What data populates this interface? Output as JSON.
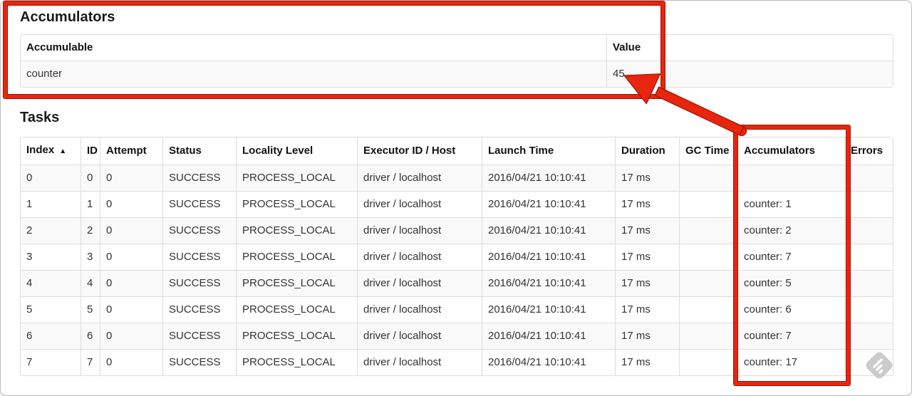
{
  "accumulators_section": {
    "title": "Accumulators",
    "table": {
      "columns": [
        "Accumulable",
        "Value"
      ],
      "rows": [
        {
          "accumulable": "counter",
          "value": "45"
        }
      ]
    }
  },
  "tasks_section": {
    "title": "Tasks",
    "table": {
      "columns": [
        "Index",
        "ID",
        "Attempt",
        "Status",
        "Locality Level",
        "Executor ID / Host",
        "Launch Time",
        "Duration",
        "GC Time",
        "Accumulators",
        "Errors"
      ],
      "sort_indicator": "▲",
      "rows": [
        {
          "index": "0",
          "id": "0",
          "attempt": "0",
          "status": "SUCCESS",
          "locality_level": "PROCESS_LOCAL",
          "executor_id_host": "driver / localhost",
          "launch_time": "2016/04/21 10:10:41",
          "duration": "17 ms",
          "gc_time": "",
          "accumulators": "",
          "errors": ""
        },
        {
          "index": "1",
          "id": "1",
          "attempt": "0",
          "status": "SUCCESS",
          "locality_level": "PROCESS_LOCAL",
          "executor_id_host": "driver / localhost",
          "launch_time": "2016/04/21 10:10:41",
          "duration": "17 ms",
          "gc_time": "",
          "accumulators": "counter: 1",
          "errors": ""
        },
        {
          "index": "2",
          "id": "2",
          "attempt": "0",
          "status": "SUCCESS",
          "locality_level": "PROCESS_LOCAL",
          "executor_id_host": "driver / localhost",
          "launch_time": "2016/04/21 10:10:41",
          "duration": "17 ms",
          "gc_time": "",
          "accumulators": "counter: 2",
          "errors": ""
        },
        {
          "index": "3",
          "id": "3",
          "attempt": "0",
          "status": "SUCCESS",
          "locality_level": "PROCESS_LOCAL",
          "executor_id_host": "driver / localhost",
          "launch_time": "2016/04/21 10:10:41",
          "duration": "17 ms",
          "gc_time": "",
          "accumulators": "counter: 7",
          "errors": ""
        },
        {
          "index": "4",
          "id": "4",
          "attempt": "0",
          "status": "SUCCESS",
          "locality_level": "PROCESS_LOCAL",
          "executor_id_host": "driver / localhost",
          "launch_time": "2016/04/21 10:10:41",
          "duration": "17 ms",
          "gc_time": "",
          "accumulators": "counter: 5",
          "errors": ""
        },
        {
          "index": "5",
          "id": "5",
          "attempt": "0",
          "status": "SUCCESS",
          "locality_level": "PROCESS_LOCAL",
          "executor_id_host": "driver / localhost",
          "launch_time": "2016/04/21 10:10:41",
          "duration": "17 ms",
          "gc_time": "",
          "accumulators": "counter: 6",
          "errors": ""
        },
        {
          "index": "6",
          "id": "6",
          "attempt": "0",
          "status": "SUCCESS",
          "locality_level": "PROCESS_LOCAL",
          "executor_id_host": "driver / localhost",
          "launch_time": "2016/04/21 10:10:41",
          "duration": "17 ms",
          "gc_time": "",
          "accumulators": "counter: 7",
          "errors": ""
        },
        {
          "index": "7",
          "id": "7",
          "attempt": "0",
          "status": "SUCCESS",
          "locality_level": "PROCESS_LOCAL",
          "executor_id_host": "driver / localhost",
          "launch_time": "2016/04/21 10:10:41",
          "duration": "17 ms",
          "gc_time": "",
          "accumulators": "counter: 17",
          "errors": ""
        }
      ]
    }
  },
  "annotations": {
    "highlight_color": "#e8250e",
    "highlight_outline_color": "#9f1405"
  },
  "icons": {
    "sort_ascending": "triangle-up",
    "watermark": "pencil-diamond-watermark"
  },
  "colors": {
    "table_border": "#dddddd",
    "row_stripe": "#f9f9f9",
    "frame_border": "#bdbdbd"
  }
}
